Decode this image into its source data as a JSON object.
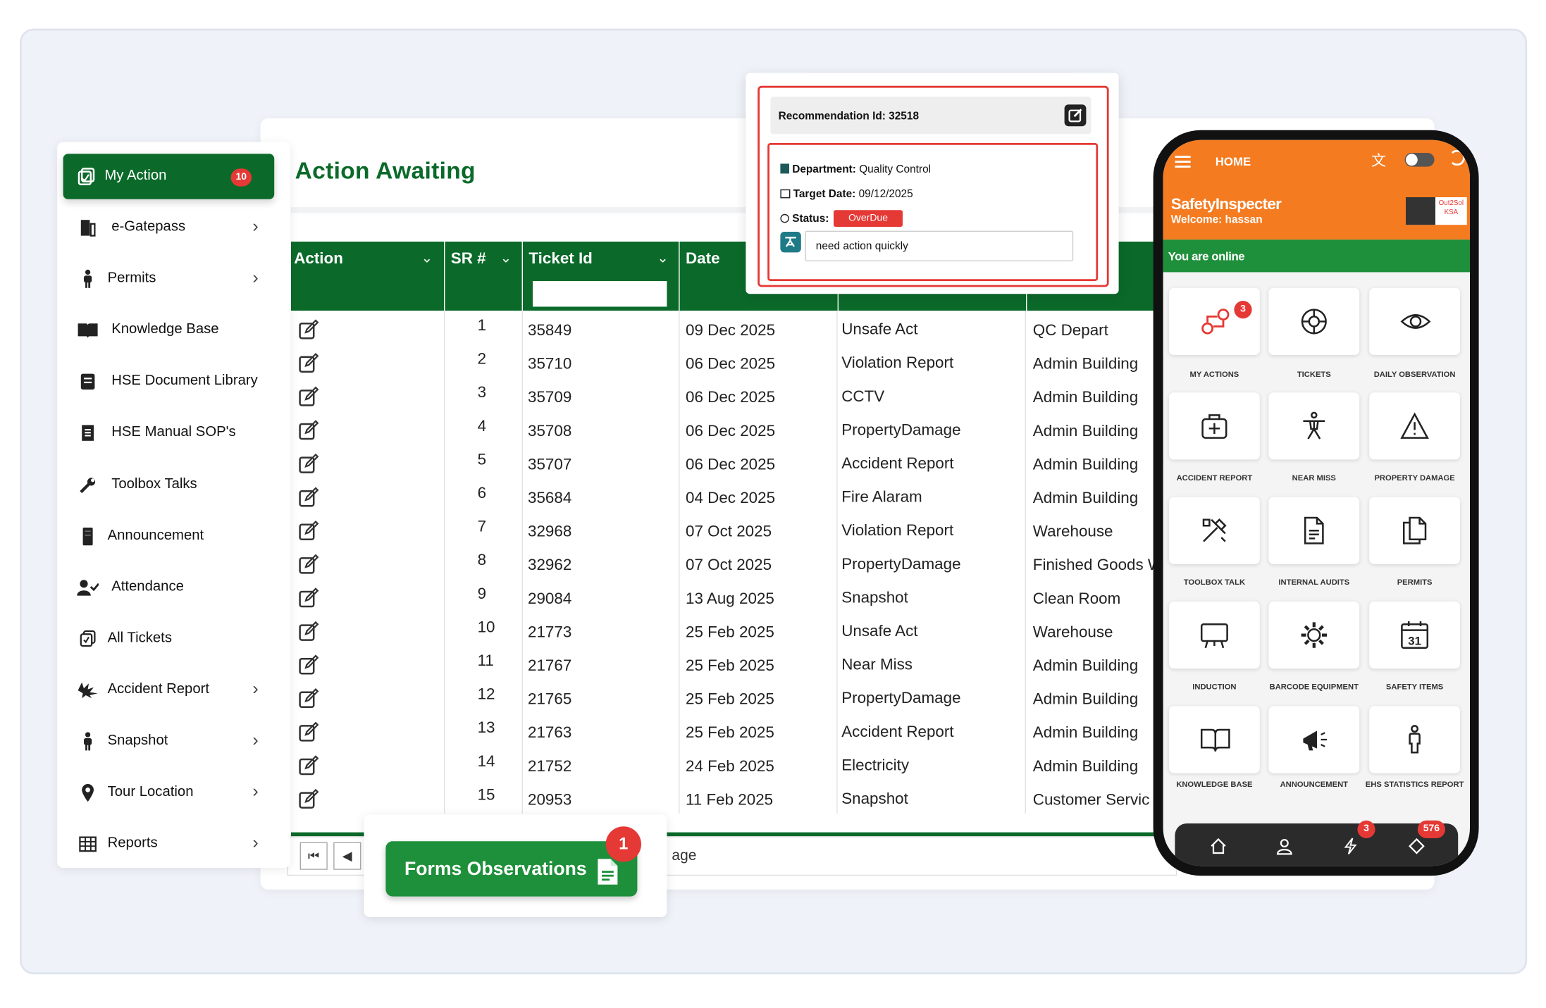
{
  "sidebar": {
    "active": {
      "label": "My Action",
      "count": "10"
    },
    "items": [
      {
        "label": "e-Gatepass",
        "icon": "gatepass-icon",
        "chevron": true
      },
      {
        "label": "Permits",
        "icon": "person-icon",
        "chevron": true
      },
      {
        "label": "Knowledge Base",
        "icon": "book-icon",
        "chevron": false
      },
      {
        "label": "HSE Document Library",
        "icon": "document-library-icon",
        "chevron": false
      },
      {
        "label": "HSE Manual SOP's",
        "icon": "manual-icon",
        "chevron": false
      },
      {
        "label": "Toolbox Talks",
        "icon": "wrench-icon",
        "chevron": false
      },
      {
        "label": "Announcement",
        "icon": "announcement-icon",
        "chevron": false
      },
      {
        "label": "Attendance",
        "icon": "user-check-icon",
        "chevron": false
      },
      {
        "label": "All Tickets",
        "icon": "tickets-icon",
        "chevron": false
      },
      {
        "label": "Accident Report",
        "icon": "accident-icon",
        "chevron": true
      },
      {
        "label": "Snapshot",
        "icon": "person-icon",
        "chevron": true
      },
      {
        "label": "Tour Location",
        "icon": "location-pin-icon",
        "chevron": true
      },
      {
        "label": "Reports",
        "icon": "table-icon",
        "chevron": true
      }
    ]
  },
  "main": {
    "title": "Action Awaiting",
    "columns": [
      "Action",
      "SR #",
      "Ticket Id",
      "Date"
    ],
    "rows": [
      {
        "sr": "1",
        "ticket": "35849",
        "date": "09 Dec 2025",
        "type": "Unsafe Act",
        "location": "QC Depart"
      },
      {
        "sr": "2",
        "ticket": "35710",
        "date": "06 Dec 2025",
        "type": "Violation Report",
        "location": "Admin Building"
      },
      {
        "sr": "3",
        "ticket": "35709",
        "date": "06 Dec 2025",
        "type": "CCTV",
        "location": "Admin Building"
      },
      {
        "sr": "4",
        "ticket": "35708",
        "date": "06 Dec 2025",
        "type": "PropertyDamage",
        "location": "Admin Building"
      },
      {
        "sr": "5",
        "ticket": "35707",
        "date": "06 Dec 2025",
        "type": "Accident Report",
        "location": "Admin Building"
      },
      {
        "sr": "6",
        "ticket": "35684",
        "date": "04 Dec 2025",
        "type": "Fire Alaram",
        "location": "Admin Building"
      },
      {
        "sr": "7",
        "ticket": "32968",
        "date": "07 Oct 2025",
        "type": "Violation Report",
        "location": "Warehouse"
      },
      {
        "sr": "8",
        "ticket": "32962",
        "date": "07 Oct 2025",
        "type": "PropertyDamage",
        "location": "Finished Goods W"
      },
      {
        "sr": "9",
        "ticket": "29084",
        "date": "13 Aug 2025",
        "type": "Snapshot",
        "location": "Clean Room"
      },
      {
        "sr": "10",
        "ticket": "21773",
        "date": "25 Feb 2025",
        "type": "Unsafe Act",
        "location": "Warehouse"
      },
      {
        "sr": "11",
        "ticket": "21767",
        "date": "25 Feb 2025",
        "type": "Near Miss",
        "location": "Admin Building"
      },
      {
        "sr": "12",
        "ticket": "21765",
        "date": "25 Feb 2025",
        "type": "PropertyDamage",
        "location": "Admin Building"
      },
      {
        "sr": "13",
        "ticket": "21763",
        "date": "25 Feb 2025",
        "type": "Accident Report",
        "location": "Admin Building"
      },
      {
        "sr": "14",
        "ticket": "21752",
        "date": "24 Feb 2025",
        "type": "Electricity",
        "location": "Admin Building"
      },
      {
        "sr": "15",
        "ticket": "20953",
        "date": "11 Feb 2025",
        "type": "Snapshot",
        "location": "Customer Servic"
      }
    ],
    "pager_text": "age"
  },
  "forms": {
    "label": "Forms Observations",
    "badge": "1"
  },
  "recommendation": {
    "title": "Recommendation Id: 32518",
    "department_label": "Department:",
    "department": "Quality Control",
    "target_label": "Target Date:",
    "target_date": "09/12/2025",
    "status_label": "Status:",
    "status": "OverDue",
    "note": "need action quickly"
  },
  "phone": {
    "header": "HOME",
    "app_name": "SafetyInspecter",
    "welcome": "Welcome: hassan",
    "logo_text": "Out2Sol KSA",
    "online": "You are online",
    "tiles": [
      {
        "label": "MY ACTIONS",
        "icon": "my-actions-icon",
        "badge": "3"
      },
      {
        "label": "TICKETS",
        "icon": "tickets-icon"
      },
      {
        "label": "DAILY OBSERVATION",
        "icon": "eye-icon"
      },
      {
        "label": "ACCIDENT REPORT",
        "icon": "first-aid-kit-icon"
      },
      {
        "label": "NEAR MISS",
        "icon": "figure-icon"
      },
      {
        "label": "PROPERTY DAMAGE",
        "icon": "warning-icon"
      },
      {
        "label": "TOOLBOX TALK",
        "icon": "tools-icon"
      },
      {
        "label": "INTERNAL AUDITS",
        "icon": "document-icon"
      },
      {
        "label": "PERMITS",
        "icon": "documents-icon"
      },
      {
        "label": "INDUCTION",
        "icon": "presentation-icon"
      },
      {
        "label": "BARCODE EQUIPMENT",
        "icon": "gear-icon"
      },
      {
        "label": "SAFETY ITEMS",
        "icon": "calendar-icon"
      },
      {
        "label": "KNOWLEDGE BASE",
        "icon": "book-icon"
      },
      {
        "label": "ANNOUNCEMENT",
        "icon": "megaphone-icon"
      },
      {
        "label": "EHS STATISTICS REPORT",
        "icon": "person-icon"
      }
    ],
    "calendar_day": "31",
    "nav_badges": {
      "actions": "3",
      "tickets": "576"
    }
  },
  "colors": {
    "brand_green": "#0b6a2a",
    "accent_orange": "#f47b20",
    "alert_red": "#e53935"
  }
}
